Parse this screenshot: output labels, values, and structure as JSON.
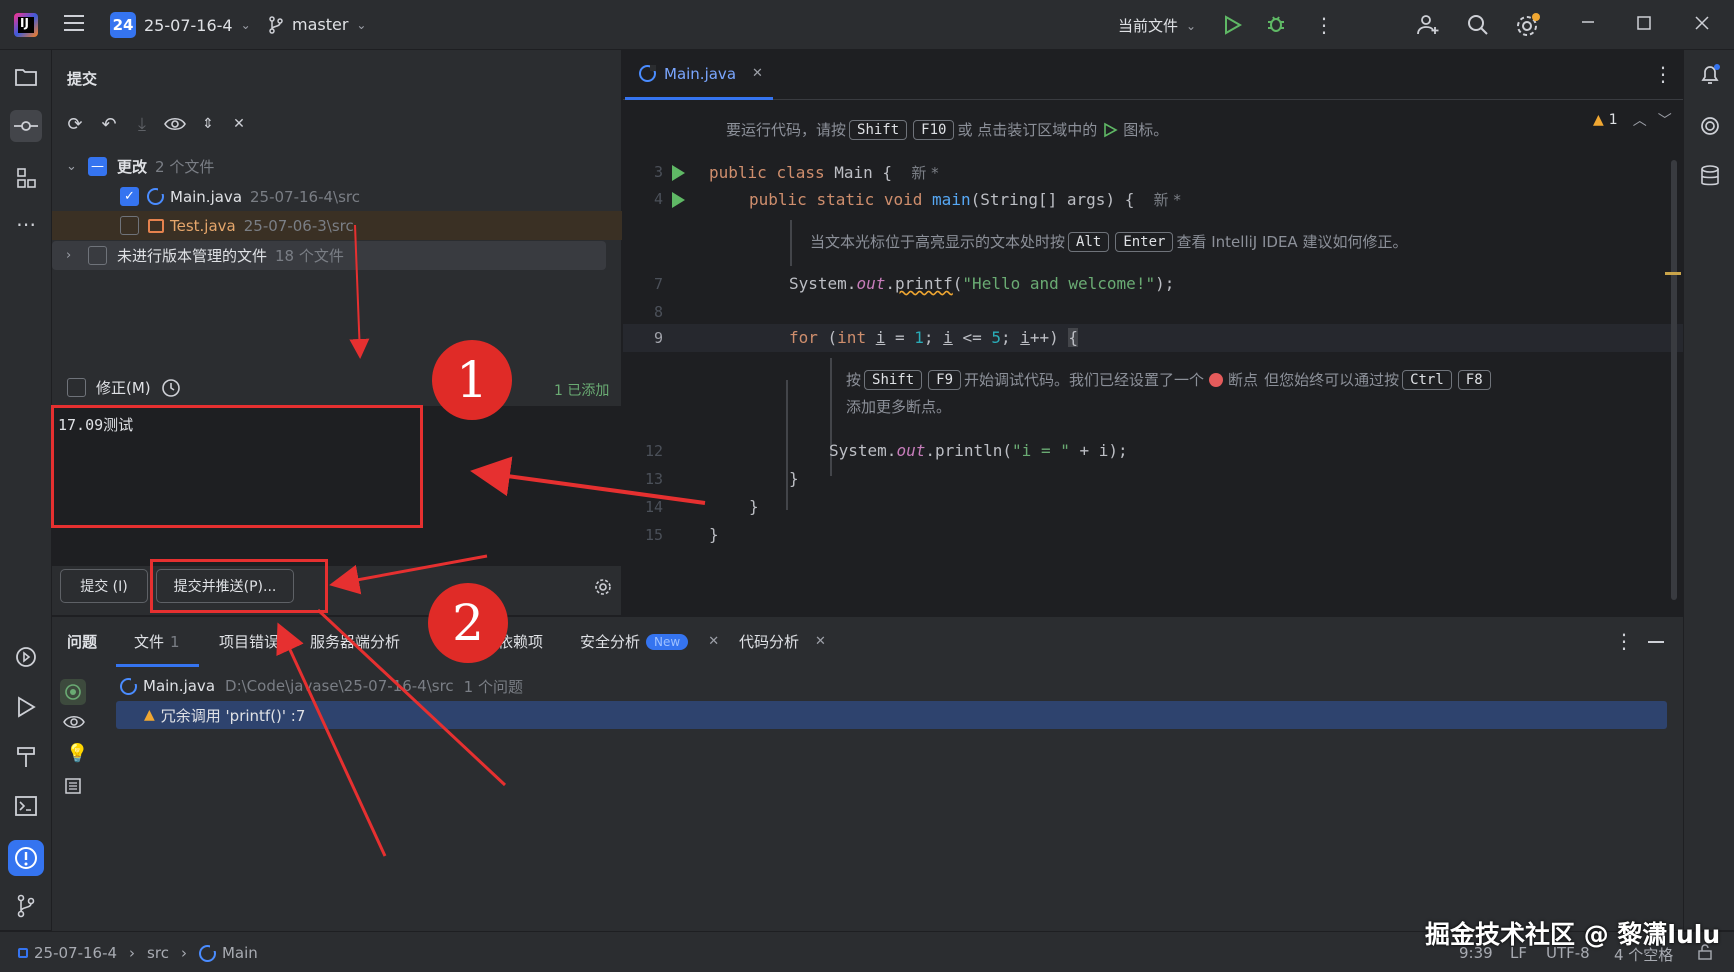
{
  "titlebar": {
    "project_badge": "24",
    "project_name": "25-07-16-4",
    "branch": "master",
    "run_config": "当前文件"
  },
  "commit_panel": {
    "title": "提交",
    "changes_label": "更改",
    "changes_count": "2 个文件",
    "files": [
      {
        "name": "Main.java",
        "path": "25-07-16-4\\src",
        "checked": true
      },
      {
        "name": "Test.java",
        "path": "25-07-06-3\\src",
        "checked": false
      }
    ],
    "unversioned_label": "未进行版本管理的文件",
    "unversioned_count": "18 个文件",
    "amend_label": "修正(M)",
    "added_status": "1 已添加",
    "message": "17.09测试",
    "commit_button": "提交 (I)",
    "commit_push_button": "提交并推送(P)..."
  },
  "editor": {
    "tab": "Main.java",
    "warning_count": "1",
    "run_hint": {
      "prefix": "要运行代码，请按",
      "key1": "Shift",
      "key2": "F10",
      "middle": "或 点击装订区域中的",
      "suffix": "图标。"
    },
    "line3": {
      "num": "3",
      "code_kw1": "public",
      "code_kw2": "class",
      "code_rest": "Main {",
      "author": "新 *"
    },
    "line4": {
      "num": "4",
      "code_kw1": "public",
      "code_kw2": "static",
      "code_kw3": "void",
      "fn": "main",
      "rest": "(String[] args) {",
      "author": "新 *"
    },
    "hint2": {
      "prefix": "当文本光标位于高亮显示的文本处时按",
      "key1": "Alt",
      "key2": "Enter",
      "suffix": "查看 IntelliJ IDEA 建议如何修正。"
    },
    "line7": {
      "num": "7",
      "obj": "System.",
      "out": "out",
      "dot": ".",
      "fn": "printf",
      "open": "(",
      "str": "\"Hello and welcome!\"",
      "close": ");"
    },
    "line8": {
      "num": "8"
    },
    "line9": {
      "num": "9"
    },
    "hint3": {
      "prefix": "按",
      "key1": "Shift",
      "key2": "F9",
      "middle": "开始调试代码。我们已经设置了一个",
      "bp": "断点",
      "middle2": "但您始终可以通过按",
      "key3": "Ctrl",
      "key4": "F8",
      "line2": "添加更多断点。"
    },
    "line12": {
      "num": "12",
      "obj": "System.",
      "out": "out",
      "rest1": ".println(",
      "str": "\"i = \"",
      "rest2": " + i);"
    },
    "line13": {
      "num": "13",
      "code": "}"
    },
    "line14": {
      "num": "14",
      "code": "}"
    },
    "line15": {
      "num": "15",
      "code": "}"
    }
  },
  "problems": {
    "tabs": [
      {
        "label": "问题"
      },
      {
        "label": "文件",
        "count": "1"
      },
      {
        "label": "项目错误"
      },
      {
        "label": "服务器端分析"
      },
      {
        "label": "依赖项"
      },
      {
        "label": "安全分析",
        "badge": "New"
      },
      {
        "label": "代码分析"
      }
    ],
    "file_row": {
      "name": "Main.java",
      "path": "D:\\Code\\javase\\25-07-16-4\\src",
      "count": "1 个问题"
    },
    "issue_row": {
      "text": "冗余调用 'printf()' :7"
    }
  },
  "statusbar": {
    "crumbs": [
      "25-07-16-4",
      "src",
      "Main"
    ],
    "position": "9:39",
    "line_sep": "LF",
    "encoding": "UTF-8",
    "indent": "4 个空格"
  },
  "annotations": {
    "circle1": "1",
    "circle2": "2",
    "watermark": "掘金技术社区 @ 黎潇lulu"
  },
  "colors": {
    "accent": "#3574f0",
    "annotation_red": "#e63030",
    "run_green": "#5fb865"
  }
}
